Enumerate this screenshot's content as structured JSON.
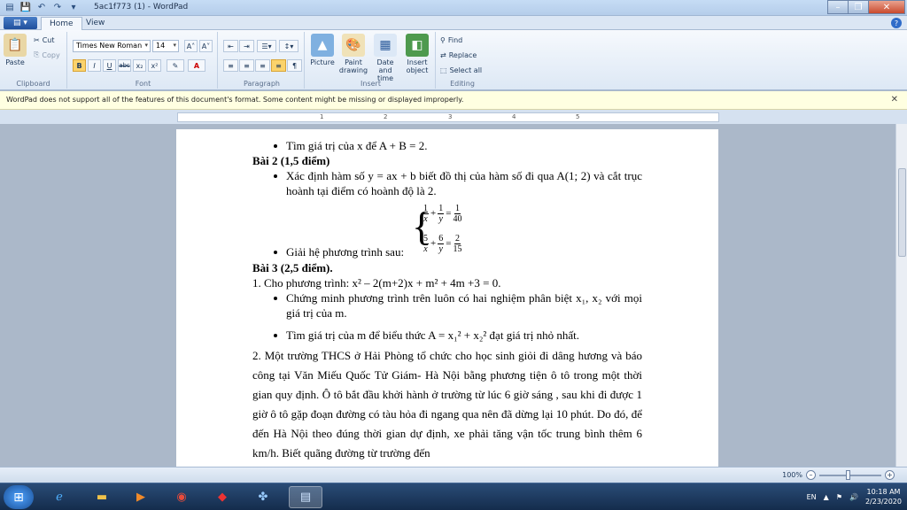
{
  "window": {
    "title": "5ac1f773 (1) - WordPad"
  },
  "tabs": {
    "file": "▤ ▾",
    "home": "Home",
    "view": "View"
  },
  "ribbon": {
    "clipboard": {
      "label": "Clipboard",
      "paste": "Paste",
      "cut": "Cut",
      "copy": "Copy"
    },
    "font": {
      "label": "Font",
      "family": "Times New Roman",
      "size": "14",
      "bold": "B",
      "italic": "I",
      "underline": "U",
      "strike": "abc",
      "sub": "x₂",
      "sup": "x²"
    },
    "paragraph": {
      "label": "Paragraph"
    },
    "insert": {
      "label": "Insert",
      "picture": "Picture",
      "paint": "Paint drawing",
      "datetime": "Date and time",
      "object": "Insert object"
    },
    "editing": {
      "label": "Editing",
      "find": "Find",
      "replace": "Replace",
      "selectall": "Select all"
    }
  },
  "infobar": {
    "message": "WordPad does not support all of the features of this document's format. Some content might be missing or displayed improperly."
  },
  "ruler": {
    "ticks": [
      "1",
      "2",
      "3",
      "4",
      "5"
    ]
  },
  "document": {
    "l1": "Tìm giá trị của x để A + B = 2.",
    "l2": "Bài 2 (1,5 điểm)",
    "l3": "Xác định hàm số y = ax + b biết đồ thị của hàm số đi qua A(1; 2) và cắt trục hoành tại điểm có hoành độ là 2.",
    "eq1": {
      "a_num": "1",
      "a_den": "x",
      "b_num": "1",
      "b_den": "y",
      "c_num": "1",
      "c_den": "40"
    },
    "eq2": {
      "a_num": "5",
      "a_den": "x",
      "b_num": "6",
      "b_den": "y",
      "c_num": "2",
      "c_den": "15"
    },
    "l4": "Giải hệ phương trình sau:",
    "l5": "Bài 3 (2,5 điểm).",
    "l6": "1. Cho phương trình: x² – 2(m+2)x + m² + 4m +3 = 0.",
    "l7": "Chứng minh phương trình trên luôn có hai nghiệm phân biệt x₁, x₂ với mọi giá trị của m.",
    "l8": "Tìm giá trị của m để biểu thức A = x₁² + x₂² đạt giá trị nhỏ nhất.",
    "l9": "2. Một trường THCS ở Hải Phòng tổ chức cho học sinh giỏi đi dâng hương và báo công tại Văn Miếu Quốc Tử Giám- Hà Nội bằng phương tiện ô tô trong một thời gian quy định. Ô tô bắt đầu khởi hành ở trường từ lúc 6 giờ sáng , sau khi đi được 1 giờ ô tô gặp đoạn đường có tàu hỏa đi ngang qua nên đã dừng lại 10 phút. Do đó, để đến Hà Nội theo đúng thời gian dự định, xe phải tăng vận tốc trung bình thêm 6 km/h. Biết quãng đường từ trường đến"
  },
  "status": {
    "zoom": "100%"
  },
  "taskbar": {
    "lang": "EN",
    "time": "10:18 AM",
    "date": "2/23/2020"
  }
}
